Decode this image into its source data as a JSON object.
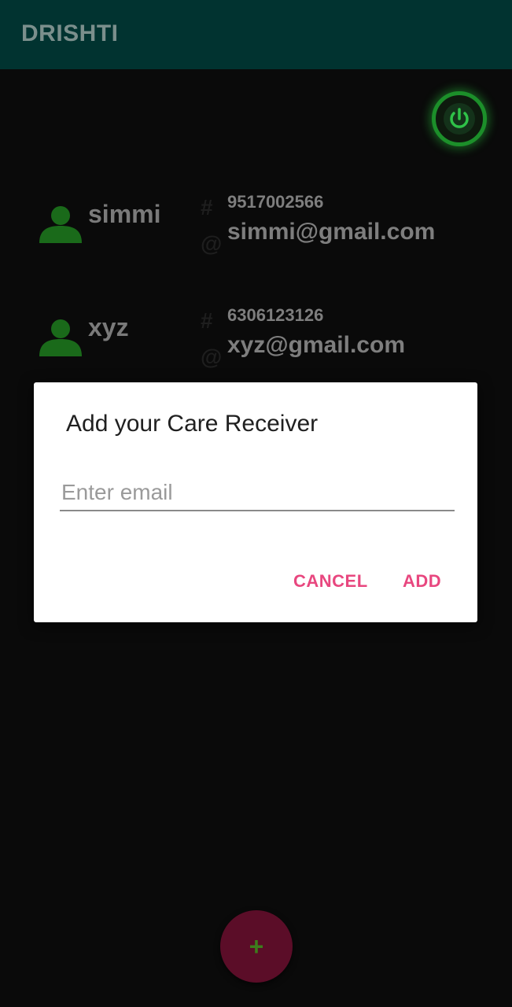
{
  "app": {
    "title": "DRISHTI"
  },
  "power": {
    "icon": "power-icon",
    "color": "#1c8f2a"
  },
  "contacts": [
    {
      "name": "simmi",
      "phone": "9517002566",
      "email": "simmi@gmail.com",
      "hash_symbol": "#",
      "at_symbol": "@"
    },
    {
      "name": "xyz",
      "phone": "6306123126",
      "email": "xyz@gmail.com",
      "hash_symbol": "#",
      "at_symbol": "@"
    }
  ],
  "dialog": {
    "title": "Add your Care Receiver",
    "email_placeholder": "Enter email",
    "email_value": "",
    "cancel_label": "CANCEL",
    "add_label": "ADD"
  },
  "fab": {
    "label": "+",
    "icon": "plus-icon",
    "color": "#5b0d28"
  },
  "colors": {
    "appbar": "#013330",
    "accent": "#e8477f",
    "avatar": "#1a6a1a"
  }
}
